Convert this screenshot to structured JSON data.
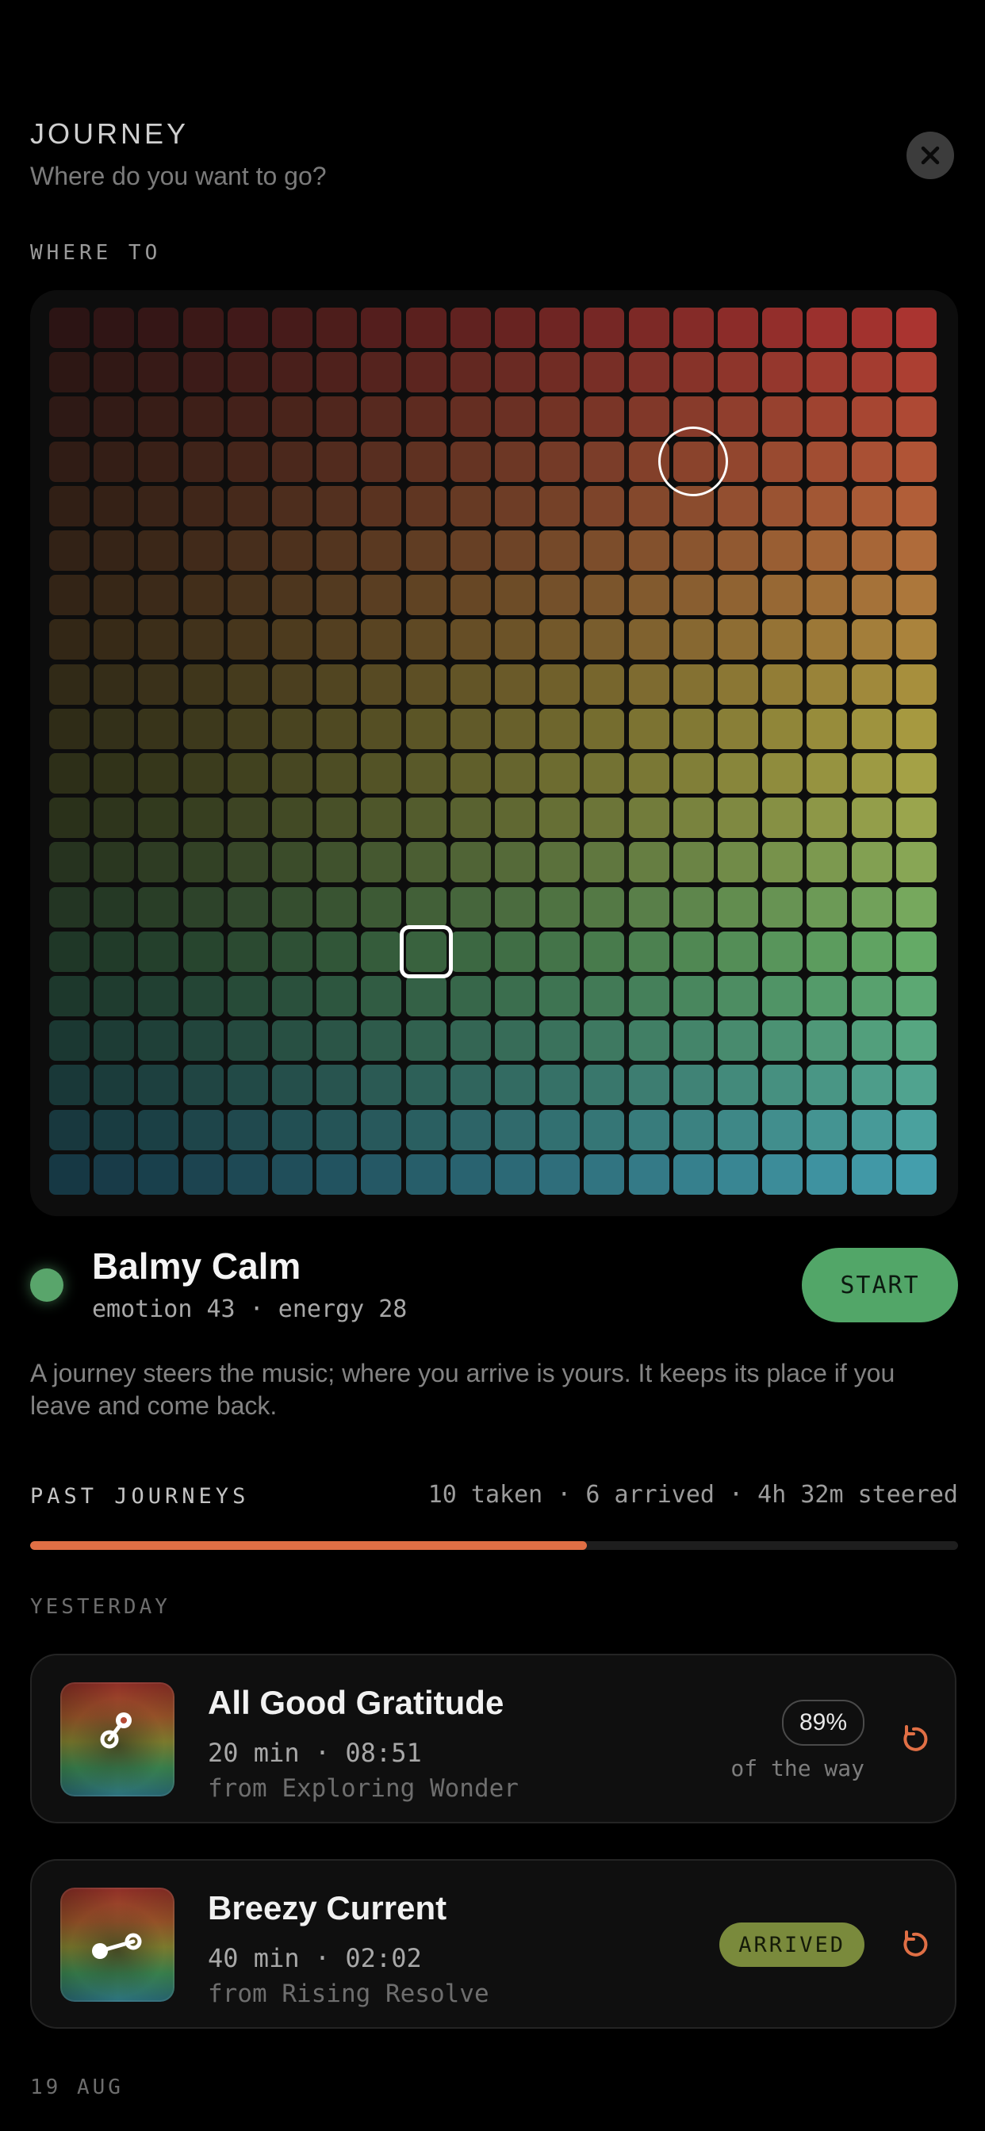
{
  "header": {
    "title": "JOURNEY",
    "subtitle": "Where do you want to go?"
  },
  "picker": {
    "label": "WHERE TO",
    "grid_columns": 20,
    "grid_rows": 20,
    "target_cell": {
      "col": 14,
      "row": 3
    },
    "current_cell": {
      "col": 8,
      "row": 14
    }
  },
  "selection": {
    "name": "Balmy Calm",
    "stats": "emotion 43 · energy 28",
    "start_label": "START",
    "color": "#59a56b"
  },
  "description": "A journey steers the music; where you arrive is yours. It keeps its place if you leave and come back.",
  "past": {
    "label": "PAST JOURNEYS",
    "stats": "10 taken · 6 arrived · 4h 32m steered",
    "progress_fraction": 0.6,
    "accent": "#e06f45"
  },
  "groups": {
    "yesterday": "YESTERDAY",
    "aug": "19 AUG"
  },
  "journeys": [
    {
      "title": "All Good Gratitude",
      "meta": "20 min · 08:51",
      "from": "from Exploring Wonder",
      "percent": "89%",
      "percent_sub": "of the way",
      "icon": "path-icon"
    },
    {
      "title": "Breezy Current",
      "meta": "40 min · 02:02",
      "from": "from Rising Resolve",
      "status": "ARRIVED",
      "icon": "path-icon"
    }
  ]
}
